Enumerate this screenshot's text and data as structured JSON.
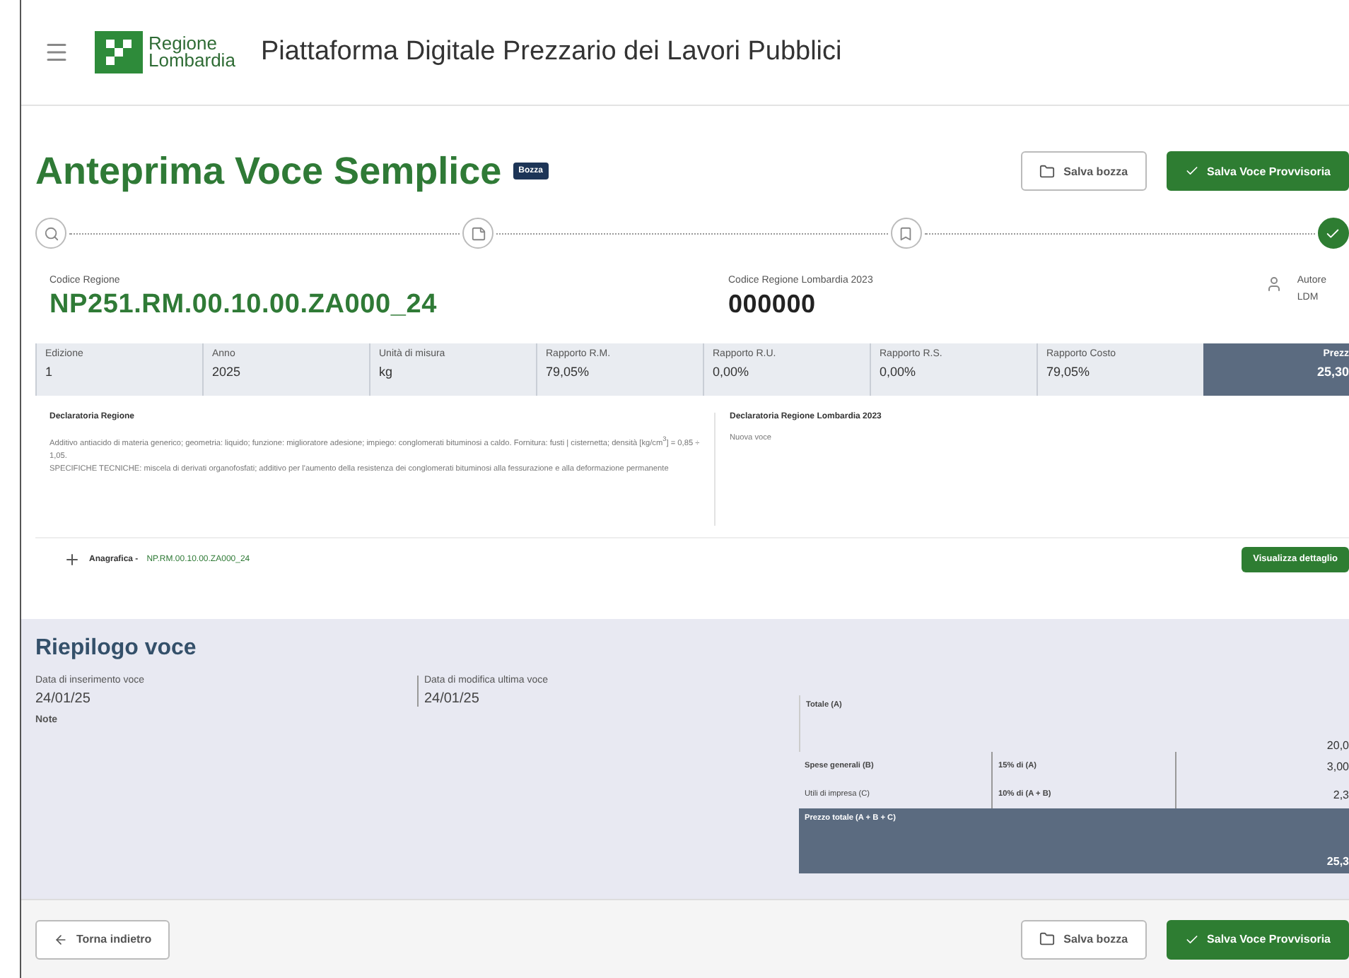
{
  "header": {
    "brand_line1": "Regione",
    "brand_line2": "Lombardia",
    "title": "Piattaforma Digitale Prezzario dei Lavori Pubblici"
  },
  "page": {
    "title": "Anteprima Voce Semplice",
    "badge": "Bozza",
    "actions": [
      {
        "kind": "outline",
        "label": "Salva bozza"
      },
      {
        "kind": "primary",
        "label": "Salva Voce Provvisoria"
      }
    ]
  },
  "stepper": [
    {
      "kind": "search",
      "done": false
    },
    {
      "kind": "note",
      "done": false
    },
    {
      "kind": "bookmark",
      "done": false
    },
    {
      "kind": "check",
      "done": true
    }
  ],
  "codes": [
    {
      "label": "Codice Regione",
      "value": "NP251.RM.00.10.00.ZA000_24",
      "kind": "primary"
    },
    {
      "label": "Codice Regione Lombardia 2023",
      "value": "000000",
      "kind": "secondary"
    }
  ],
  "author": {
    "label": "Autore",
    "value": "LDM"
  },
  "metrics": [
    {
      "label": "Edizione",
      "value": "1"
    },
    {
      "label": "Anno",
      "value": "2025"
    },
    {
      "label": "Unità di misura",
      "value": "kg"
    },
    {
      "label": "Rapporto R.M.",
      "value": "79,05%"
    },
    {
      "label": "Rapporto R.U.",
      "value": "0,00%"
    },
    {
      "label": "Rapporto R.S.",
      "value": "0,00%"
    },
    {
      "label": "Rapporto Costo",
      "value": "79,05%"
    }
  ],
  "price": {
    "label": "Prezz",
    "value": "25,30"
  },
  "declaratoria": [
    {
      "label": "Declaratoria Regione",
      "paragraphs": [
        "Additivo antiacido di materia generico; geometria: liquido; funzione: miglioratore adesione; impiego: conglomerati bituminosi a caldo. Fornitura: fusti | cisternetta; densità [kg/cm$^{3}$] = 0,85 ÷ 1,05.",
        "SPECIFICHE TECNICHE: miscela di derivati organofosfati; additivo per l'aumento della resistenza dei conglomerati bituminosi alla fessurazione e alla deformazione permanente"
      ]
    },
    {
      "label": "Declaratoria Regione Lombardia 2023",
      "paragraphs": [
        "Nuova voce"
      ]
    }
  ],
  "anagrafica": {
    "label": "Anagrafica -",
    "code": "NP.RM.00.10.00.ZA000_24",
    "button": "Visualizza dettaglio"
  },
  "summary": {
    "title": "Riepilogo voce",
    "dates": [
      {
        "label": "Data di inserimento voce",
        "value": "24/01/25"
      },
      {
        "label": "Data di modifica ultima voce",
        "value": "24/01/25"
      }
    ],
    "note_label": "Note",
    "total": {
      "label": "Totale (A)",
      "value": "20,0"
    },
    "rows": [
      {
        "label": "Spese generali (B)",
        "rate": "15% di (A)",
        "value": "3,00",
        "bold": true
      },
      {
        "label": "Utili di impresa (C)",
        "rate": "10% di (A + B)",
        "value": "2,3",
        "bold": false
      }
    ],
    "grand": {
      "label": "Prezzo totale (A + B + C)",
      "value": "25,3"
    }
  },
  "footer": {
    "back": "Torna indietro",
    "actions": [
      {
        "kind": "outline",
        "label": "Salva bozza"
      },
      {
        "kind": "primary",
        "label": "Salva Voce Provvisoria"
      }
    ]
  }
}
